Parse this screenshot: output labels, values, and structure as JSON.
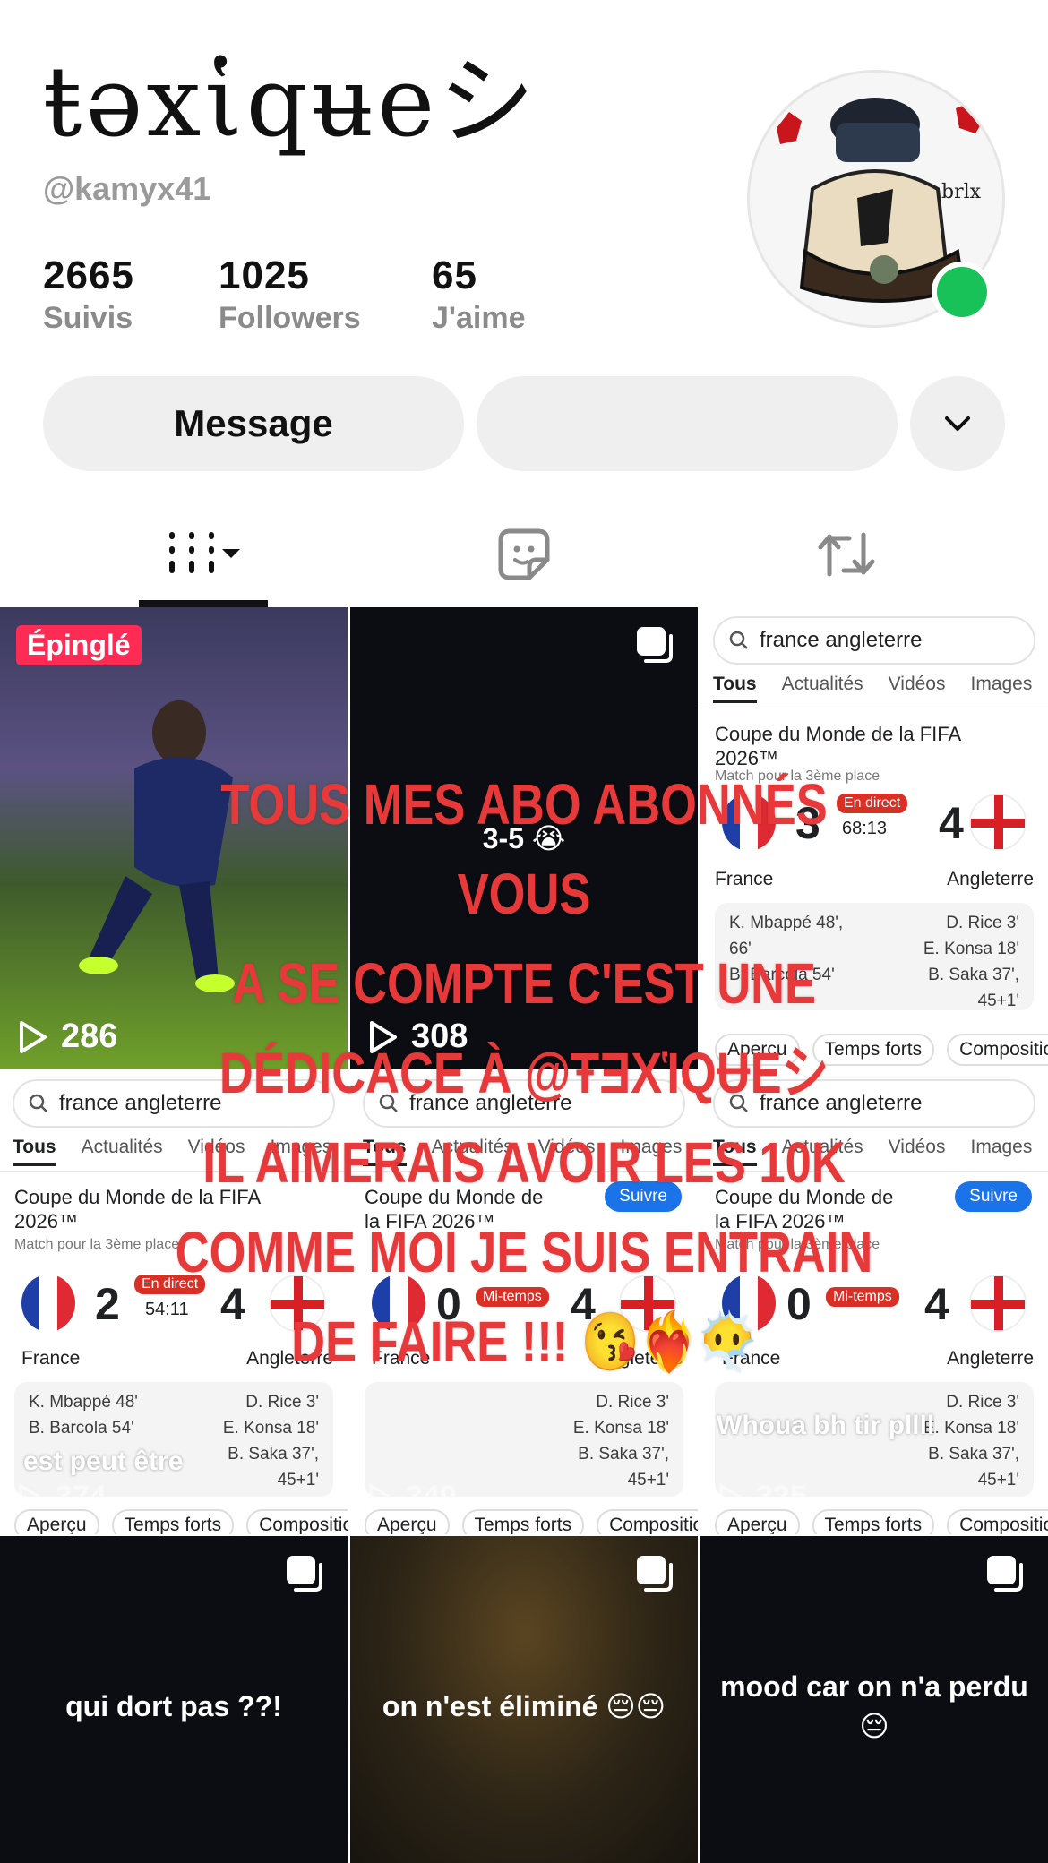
{
  "profile": {
    "display_name": "ŧǝxἱqʉeシ",
    "username": "@kamyx41",
    "stats": [
      {
        "value": "2665",
        "label": "Suivis"
      },
      {
        "value": "1025",
        "label": "Followers"
      },
      {
        "value": "65",
        "label": "J'aime"
      }
    ],
    "message_label": "Message",
    "online_color": "#19c258"
  },
  "tabs": [
    {
      "icon": "grid-videos-icon",
      "selected": true
    },
    {
      "icon": "reposts-sticker-icon"
    },
    {
      "icon": "repost-arrows-icon"
    }
  ],
  "overlay": {
    "lines": [
      "Tous mes abo abonnés vous",
      "a se compte c'est une",
      "dédicace à @ŧǝxἱqʉeシ",
      "il aimerais avoir les 10k",
      "comme moi je suis entrain",
      "de faire !!! 😘❤️‍🔥😶‍🌫️"
    ],
    "color": "#e8393a"
  },
  "videos": {
    "v1": {
      "badge": "Épinglé",
      "views": "286"
    },
    "v2": {
      "text": "3-5 😭",
      "views": "308"
    },
    "v3": {
      "search": "france angleterre",
      "tabs": [
        "Tous",
        "Actualités",
        "Vidéos",
        "Images"
      ],
      "title": "Coupe du Monde de la FIFA 2026™",
      "subtitle": "Match pour la 3ème place",
      "score_left": "3",
      "score_right": "4",
      "status": "En direct",
      "clock": "68:13",
      "team_left": "France",
      "team_right": "Angleterre",
      "scorers_left": [
        "K. Mbappé 48',",
        "66'",
        "B. Barcola 54'"
      ],
      "scorers_right": [
        "D. Rice 3'",
        "E. Konsa 18'",
        "B. Saka 37',",
        "45+1'"
      ],
      "chips": [
        "Aperçu",
        "Temps forts",
        "Composition"
      ]
    },
    "v4": {
      "search": "france angleterre",
      "tabs": [
        "Tous",
        "Actualités",
        "Vidéos",
        "Images"
      ],
      "title": "Coupe du Monde de la FIFA 2026™",
      "subtitle": "Match pour la 3ème place",
      "score_left": "2",
      "score_right": "4",
      "status": "En direct",
      "clock": "54:11",
      "team_left": "France",
      "team_right": "Angleterre",
      "scorers_left": [
        "K. Mbappé 48'",
        "B. Barcola 54'"
      ],
      "scorers_right": [
        "D. Rice 3'",
        "E. Konsa 18'",
        "B. Saka 37',",
        "45+1'"
      ],
      "caption": "est peut être",
      "views": "374",
      "chips": [
        "Aperçu",
        "Temps forts",
        "Composition"
      ]
    },
    "v5": {
      "search": "france angleterre",
      "tabs": [
        "Tous",
        "Actualités",
        "Vidéos",
        "Images"
      ],
      "title": "Coupe du Monde de la FIFA 2026™",
      "follow": "Suivre",
      "score_left": "0",
      "score_right": "4",
      "status": "Mi-temps",
      "team_left": "France",
      "team_right": "Angleterre",
      "scorers_right": [
        "D. Rice 3'",
        "E. Konsa 18'",
        "B. Saka 37',",
        "45+1'"
      ],
      "views": "349",
      "chips": [
        "Aperçu",
        "Temps forts",
        "Composition"
      ]
    },
    "v6": {
      "search": "france angleterre",
      "tabs": [
        "Tous",
        "Actualités",
        "Vidéos",
        "Images"
      ],
      "title": "Coupe du Monde de la FIFA 2026™",
      "subtitle": "Match pour la 3ème place",
      "follow": "Suivre",
      "score_left": "0",
      "score_right": "4",
      "status": "Mi-temps",
      "team_left": "France",
      "team_right": "Angleterre",
      "scorers_right": [
        "D. Rice 3'",
        "E. Konsa 18'",
        "B. Saka 37',",
        "45+1'"
      ],
      "caption": "Whoua bh tir pllll",
      "views": "325",
      "chips": [
        "Aperçu",
        "Temps forts",
        "Composition"
      ]
    },
    "v7": {
      "text": "qui dort pas ??!"
    },
    "v8": {
      "text": "on n'est éliminé 😔😔"
    },
    "v9": {
      "text": "mood car on n'a perdu 😔"
    }
  }
}
